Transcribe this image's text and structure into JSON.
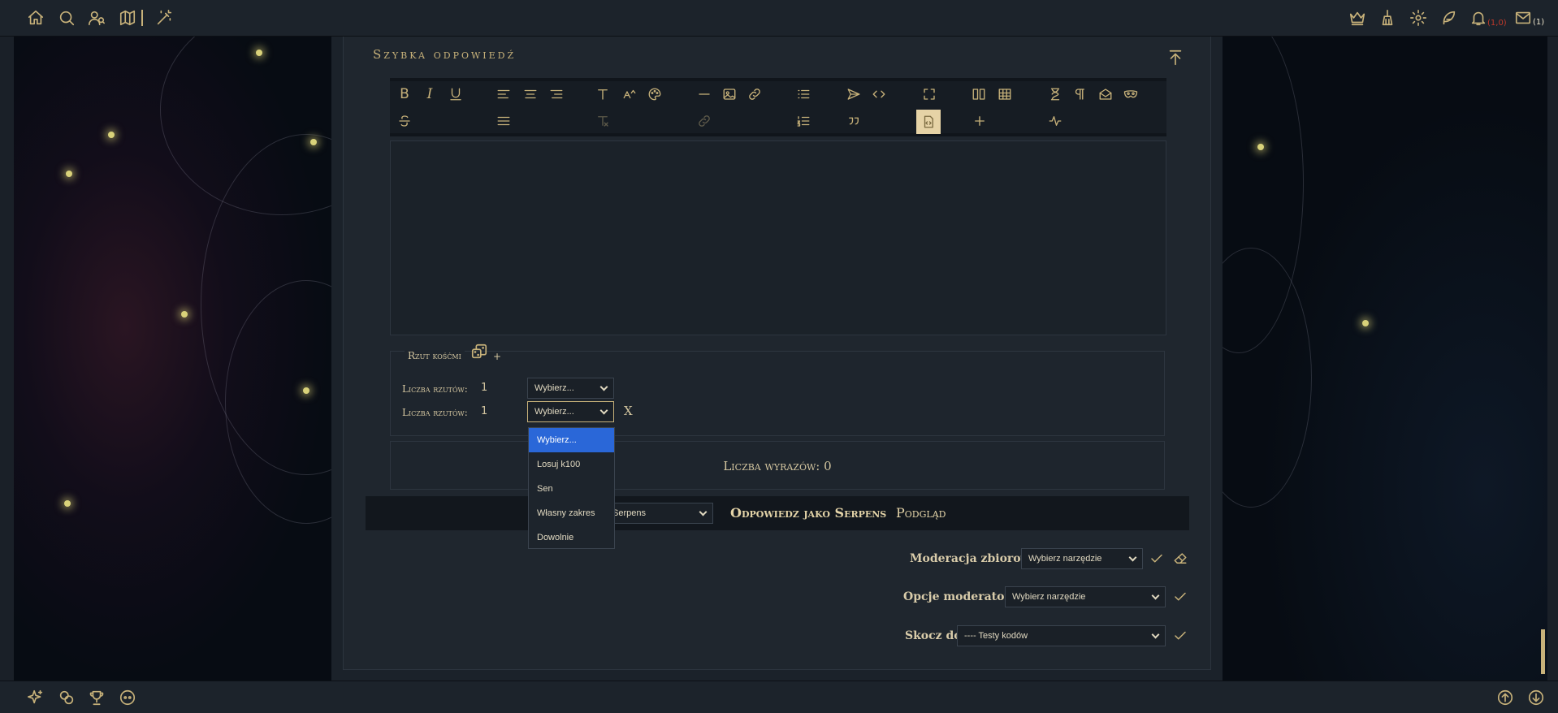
{
  "top_nav": {
    "left_icons": [
      "home-icon",
      "search-icon",
      "users-icon",
      "map-icon",
      "magic-wand-icon"
    ],
    "right_icons": [
      "crown-icon",
      "broom-icon",
      "gear-icon",
      "feather-icon",
      "bell-icon",
      "mail-icon"
    ],
    "notification_count": "(1,0)",
    "mail_count": "(1)"
  },
  "bottom_nav": {
    "left_icons": [
      "sparkles-icon",
      "links-icon",
      "trophy-icon",
      "discord-icon"
    ],
    "right_icons": [
      "scroll-up-icon",
      "scroll-down-icon"
    ]
  },
  "quick_reply": {
    "title": "Szybka odpowiedź",
    "toolbar_icons": [
      "bold-icon",
      "italic-icon",
      "underline-icon",
      "align-left-icon",
      "align-center-icon",
      "align-right-icon",
      "font-icon",
      "font-size-icon",
      "color-palette-icon",
      "horizontal-rule-icon",
      "image-icon",
      "link-icon",
      "bullet-list-icon",
      "send-icon",
      "code-icon",
      "fullscreen-icon",
      "layout-icon",
      "table-icon",
      "hourglass-icon",
      "pilcrow-icon",
      "envelope-icon",
      "mask-icon",
      "strikethrough-icon",
      "justify-icon",
      "clear-format-icon",
      "unlink-icon",
      "numbered-list-icon",
      "quote-icon",
      "source-icon",
      "plus-icon",
      "pulse-icon"
    ]
  },
  "dice": {
    "title": "Rzut kośćmi",
    "add": "+",
    "rows": [
      {
        "label": "Liczba rzutów:",
        "count": "1",
        "selected": "Wybierz..."
      },
      {
        "label": "Liczba rzutów:",
        "count": "1",
        "selected": "Wybierz..."
      }
    ],
    "remove": "X",
    "options": [
      "Wybierz...",
      "Losuj k100",
      "Sen",
      "Własny zakres",
      "Dowolnie"
    ]
  },
  "word_count": "Liczba wyrazów: 0",
  "reply_bar": {
    "character_select": "Serpens",
    "reply_as": "Odpowiedz jako Serpens",
    "preview": "Podgląd"
  },
  "moderation": {
    "bulk_label": "Moderacja zbiorowa:",
    "bulk_select": "Wybierz narzędzie",
    "mod_label": "Opcje moderatora:",
    "mod_select": "Wybierz narzędzie",
    "jump_label": "Skocz do:",
    "jump_select": "---- Testy kodów"
  },
  "colors": {
    "accent": "#c8b27a",
    "background": "#1a2028",
    "highlight": "#2a67d8"
  }
}
